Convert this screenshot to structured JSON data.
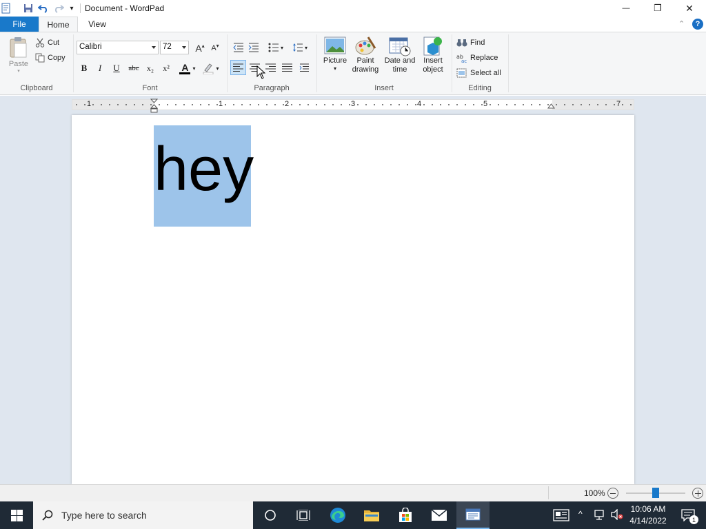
{
  "window": {
    "title": "Document - WordPad",
    "qa_more_glyph": "▾",
    "minimize_glyph": "—",
    "maximize_glyph": "❐",
    "close_glyph": "✕"
  },
  "tabs": {
    "file": "File",
    "home": "Home",
    "view": "View",
    "collapse_glyph": "⌃",
    "help_glyph": "?"
  },
  "clipboard": {
    "label": "Clipboard",
    "paste": "Paste",
    "cut": "Cut",
    "copy": "Copy"
  },
  "font": {
    "label": "Font",
    "family": "Calibri",
    "size": "72",
    "grow_glyph": "A",
    "shrink_glyph": "A",
    "bold": "B",
    "italic": "I",
    "underline": "U",
    "strike": "abc",
    "subscript": "x₂",
    "superscript": "x²",
    "color_glyph": "A"
  },
  "paragraph": {
    "label": "Paragraph"
  },
  "insert": {
    "label": "Insert",
    "picture": "Picture",
    "paint_1": "Paint",
    "paint_2": "drawing",
    "datetime_1": "Date and",
    "datetime_2": "time",
    "object_1": "Insert",
    "object_2": "object"
  },
  "editing": {
    "label": "Editing",
    "find": "Find",
    "replace": "Replace",
    "select_all": "Select all"
  },
  "ruler": {
    "numbers": [
      "1",
      "1",
      "2",
      "3",
      "4",
      "5",
      "7"
    ]
  },
  "document": {
    "text": "hey"
  },
  "status": {
    "zoom": "100%",
    "zoom_level_percent": 100
  },
  "taskbar": {
    "search_placeholder": "Type here to search",
    "time": "10:06 AM",
    "date": "4/14/2022",
    "notification_count": "1"
  },
  "colors": {
    "file_tab": "#1979ca",
    "selection": "#9dc4ea",
    "workspace": "#dfe6ef",
    "taskbar": "#1f2a36"
  }
}
